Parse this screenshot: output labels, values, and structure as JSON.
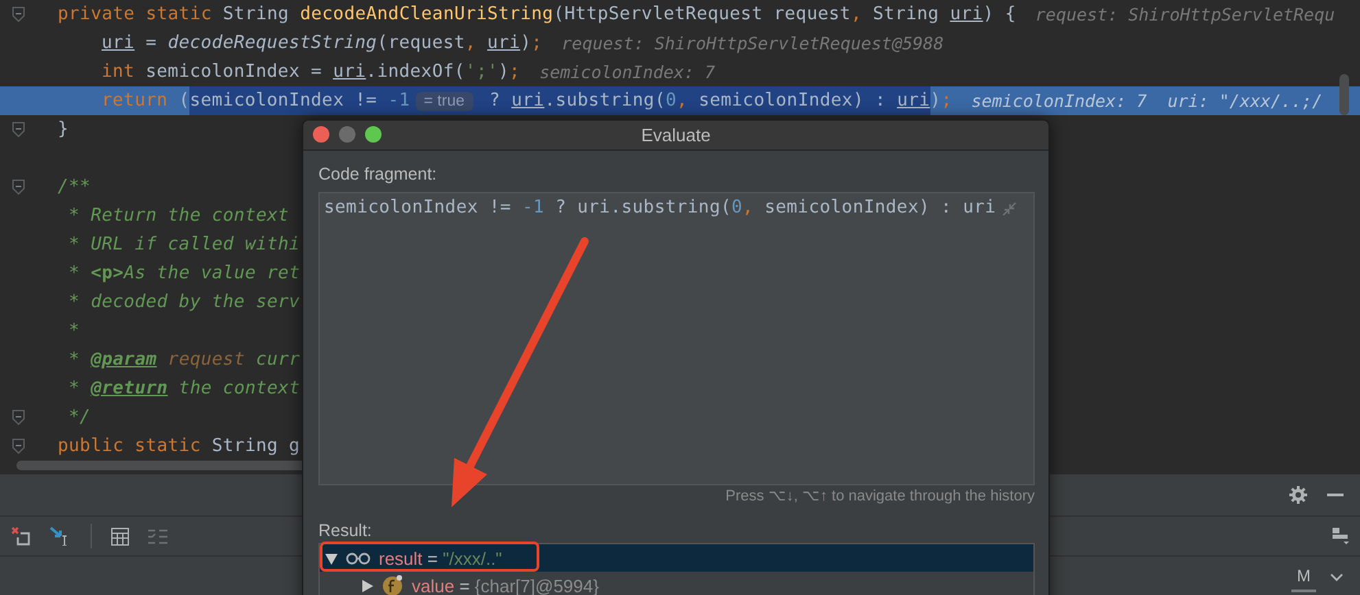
{
  "editor": {
    "lines": [
      {
        "current": false,
        "fold": true,
        "segments": [
          {
            "kind": "kw",
            "text": "private static "
          },
          {
            "kind": "text",
            "text": "String "
          },
          {
            "kind": "fn",
            "text": "decodeAndCleanUriString"
          },
          {
            "kind": "text",
            "text": "(HttpServletRequest request"
          },
          {
            "kind": "punct",
            "text": ","
          },
          {
            "kind": "text",
            "text": " String "
          },
          {
            "kind": "var",
            "text": "uri"
          },
          {
            "kind": "text",
            "text": ") {"
          }
        ],
        "hint": "request: ShiroHttpServletRequ",
        "children": [
          {
            "current": false,
            "fold": false,
            "segments": [
              {
                "kind": "var",
                "text": "uri"
              },
              {
                "kind": "text",
                "text": " = "
              },
              {
                "kind": "fni",
                "text": "decodeRequestString"
              },
              {
                "kind": "text",
                "text": "(request"
              },
              {
                "kind": "punct",
                "text": ", "
              },
              {
                "kind": "var",
                "text": "uri"
              },
              {
                "kind": "text",
                "text": ")"
              },
              {
                "kind": "punct",
                "text": ";"
              }
            ],
            "hint": "request: ShiroHttpServletRequest@5988"
          },
          {
            "current": false,
            "fold": false,
            "segments": [
              {
                "kind": "kw",
                "text": "int "
              },
              {
                "kind": "text",
                "text": "semicolonIndex = "
              },
              {
                "kind": "var",
                "text": "uri"
              },
              {
                "kind": "text",
                "text": ".indexOf("
              },
              {
                "kind": "str",
                "text": "';'"
              },
              {
                "kind": "text",
                "text": ")"
              },
              {
                "kind": "punct",
                "text": ";"
              }
            ],
            "hint": "semicolonIndex: 7"
          },
          {
            "current": true,
            "fold": false,
            "segments": [
              {
                "kind": "kw",
                "text": "return "
              },
              {
                "kind": "text",
                "text": "("
              }
            ],
            "selection": [
              {
                "kind": "text",
                "text": "semicolonIndex != "
              },
              {
                "kind": "num",
                "text": "-1"
              },
              {
                "kind": "inlay",
                "text": "= true"
              },
              {
                "kind": "text",
                "text": " ? "
              },
              {
                "kind": "var",
                "text": "uri"
              },
              {
                "kind": "text",
                "text": ".substring("
              },
              {
                "kind": "num",
                "text": "0"
              },
              {
                "kind": "punct",
                "text": ","
              },
              {
                "kind": "text",
                "text": " semicolonIndex) : "
              },
              {
                "kind": "var",
                "text": "uri"
              }
            ],
            "after": [
              {
                "kind": "text",
                "text": ")"
              },
              {
                "kind": "punct",
                "text": ";"
              }
            ],
            "hint": "semicolonIndex: 7  uri: \"/xxx/..;/"
          }
        ]
      },
      {
        "current": false,
        "fold": true,
        "segments": [
          {
            "kind": "text",
            "text": "}"
          }
        ]
      },
      {
        "current": false,
        "fold": true,
        "gap_before": true,
        "segments": [
          {
            "kind": "doc",
            "text": "/**"
          }
        ]
      },
      {
        "current": false,
        "fold": false,
        "segments": [
          {
            "kind": "doc",
            "text": " * Return the context"
          }
        ]
      },
      {
        "current": false,
        "fold": false,
        "segments": [
          {
            "kind": "doc",
            "text": " * URL if called withi"
          }
        ]
      },
      {
        "current": false,
        "fold": false,
        "segments": [
          {
            "kind": "doc",
            "text": " * "
          },
          {
            "kind": "tag",
            "text": "<p>"
          },
          {
            "kind": "doc",
            "text": "As the value ret"
          }
        ]
      },
      {
        "current": false,
        "fold": false,
        "segments": [
          {
            "kind": "doc",
            "text": " * decoded by the serv"
          }
        ]
      },
      {
        "current": false,
        "fold": false,
        "segments": [
          {
            "kind": "doc",
            "text": " *"
          }
        ]
      },
      {
        "current": false,
        "fold": false,
        "segments": [
          {
            "kind": "doc",
            "text": " * "
          },
          {
            "kind": "doctag",
            "text": "@param"
          },
          {
            "kind": "docparam",
            "text": " request"
          },
          {
            "kind": "doc",
            "text": " curr"
          }
        ]
      },
      {
        "current": false,
        "fold": false,
        "segments": [
          {
            "kind": "doc",
            "text": " * "
          },
          {
            "kind": "doctag",
            "text": "@return"
          },
          {
            "kind": "doc",
            "text": " the context"
          }
        ]
      },
      {
        "current": false,
        "fold": true,
        "segments": [
          {
            "kind": "doc",
            "text": " */"
          }
        ]
      },
      {
        "current": false,
        "fold": true,
        "segments": [
          {
            "kind": "kw",
            "text": "public static "
          },
          {
            "kind": "text",
            "text": "String g"
          }
        ]
      }
    ]
  },
  "debug_panel": {
    "tab_label": "M"
  },
  "dialog": {
    "title": "Evaluate",
    "fragment_label": "Code fragment:",
    "fragment": [
      {
        "kind": "text",
        "text": "semicolonIndex != "
      },
      {
        "kind": "num",
        "text": "-1"
      },
      {
        "kind": "text",
        "text": " ? uri.substring("
      },
      {
        "kind": "num",
        "text": "0"
      },
      {
        "kind": "punct",
        "text": ","
      },
      {
        "kind": "text",
        "text": " semicolonIndex) : uri"
      }
    ],
    "history_hint": "Press ⌥↓, ⌥↑ to navigate through the history",
    "result_label": "Result:",
    "tree": [
      {
        "kind": "watch",
        "name": "result",
        "operator": "=",
        "value": "\"/xxx/..\"",
        "expanded": true,
        "selected": true,
        "children": [
          {
            "kind": "field",
            "name": "value",
            "operator": "=",
            "value": "{char[7]@5994}",
            "expanded": false,
            "selected": false
          }
        ]
      }
    ]
  }
}
